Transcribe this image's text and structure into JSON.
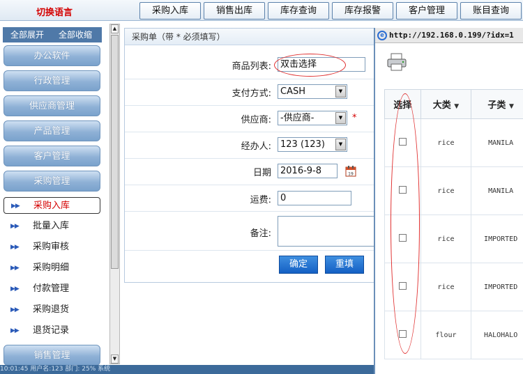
{
  "header": {
    "lang_switch": "切换语言",
    "nav": [
      "采购入库",
      "销售出库",
      "库存查询",
      "库存报警",
      "客户管理",
      "账目查询"
    ]
  },
  "sidebar": {
    "expand_all": "全部展开",
    "collapse_all": "全部收缩",
    "categories_top": [
      "办公软件",
      "行政管理",
      "供应商管理",
      "产品管理",
      "客户管理",
      "采购管理"
    ],
    "sub_items": [
      "采购入库",
      "批量入库",
      "采购审核",
      "采购明细",
      "付款管理",
      "采购退货",
      "退货记录"
    ],
    "active_sub": "采购入库",
    "category_bottom": "销售管理"
  },
  "form": {
    "title": "采购单（带 * 必须填写）",
    "product_label": "商品列表:",
    "product_value": "双击选择",
    "payment_label": "支付方式:",
    "payment_value": "CASH",
    "supplier_label": "供应商:",
    "supplier_value": "-供应商-",
    "required_mark": "*",
    "handler_label": "经办人:",
    "handler_value": "123 (123)",
    "date_label": "日期",
    "date_value": "2016-9-8",
    "shipping_label": "运费:",
    "shipping_value": "0",
    "remark_label": "备注:",
    "remark_value": "",
    "confirm_label": "确定",
    "reset_label": "重填"
  },
  "popup": {
    "url": "http://192.168.0.199/?idx=1",
    "columns": [
      "选择",
      "大类",
      "子类"
    ],
    "rows": [
      {
        "category": "rice",
        "subcategory": "MANILA"
      },
      {
        "category": "rice",
        "subcategory": "MANILA"
      },
      {
        "category": "rice",
        "subcategory": "IMPORTED"
      },
      {
        "category": "rice",
        "subcategory": "IMPORTED"
      },
      {
        "category": "flour",
        "subcategory": "HALOHALO"
      }
    ]
  },
  "statusbar": {
    "text": "10:01:45          用户名:123       部门:  25%      系统"
  },
  "colors": {
    "accent_red": "#d40000",
    "nav_blue": "#4f79a8",
    "button_blue": "#1460c4"
  },
  "icons": [
    "printer-icon",
    "calendar-icon",
    "ie-logo-icon",
    "double-arrow-icon",
    "sort-down-icon"
  ]
}
